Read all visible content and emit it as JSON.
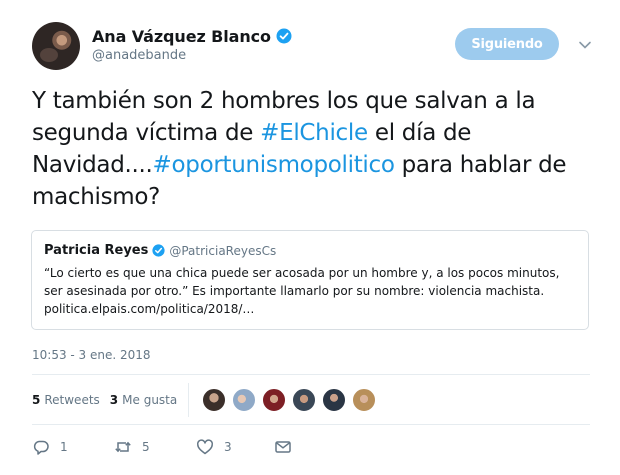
{
  "author": {
    "display_name": "Ana Vázquez Blanco",
    "handle": "@anadebande",
    "verified": true
  },
  "follow_button": {
    "label": "Siguiendo"
  },
  "tweet": {
    "text_parts": [
      "Y también son 2 hombres los que salvan a la segunda víctima de ",
      "#ElChicle",
      " el día de Navidad....",
      "#oportunismopolitico",
      " para hablar de machismo?"
    ]
  },
  "quoted_tweet": {
    "display_name": "Patricia Reyes",
    "handle": "@PatriciaReyesCs",
    "verified": true,
    "lines": [
      "“Lo cierto es que una chica puede ser acosada por un hombre y, a los pocos minutos,",
      "ser asesinada por otro.” Es importante llamarlo por su nombre: violencia machista.",
      "politica.elpais.com/politica/2018/…"
    ]
  },
  "timestamp": "10:53 - 3 ene. 2018",
  "stats": {
    "retweets_count": "5",
    "retweets_label": "Retweets",
    "likes_count": "3",
    "likes_label": "Me gusta"
  },
  "likers": [
    {
      "avatar": "user-avatar-1"
    },
    {
      "avatar": "user-avatar-2"
    },
    {
      "avatar": "user-avatar-3"
    },
    {
      "avatar": "user-avatar-4"
    },
    {
      "avatar": "user-avatar-5"
    },
    {
      "avatar": "user-avatar-6"
    }
  ],
  "actions": {
    "reply_count": "1",
    "retweet_count": "5",
    "like_count": "3"
  },
  "colors": {
    "link": "#1b95e0",
    "follow_button": "#9dcbee",
    "secondary_text": "#657786",
    "verified": "#1da1f2"
  }
}
